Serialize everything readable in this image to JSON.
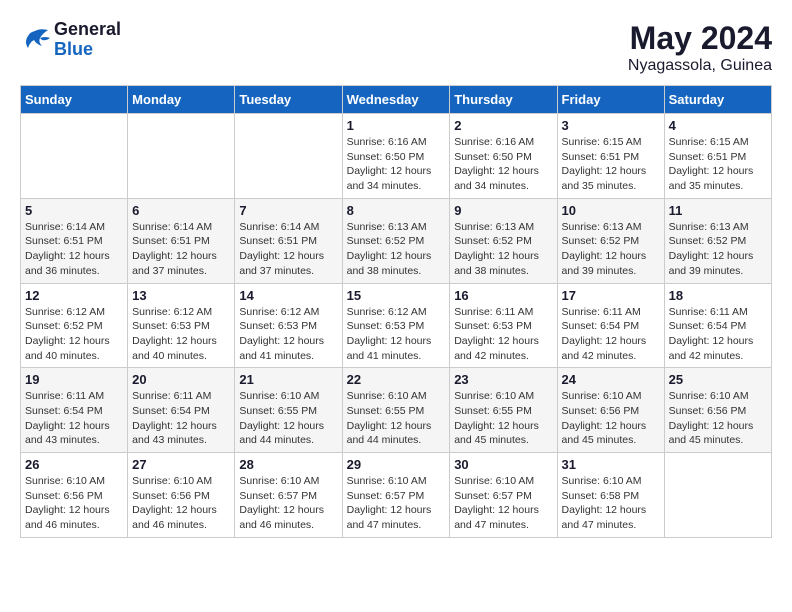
{
  "header": {
    "logo_line1": "General",
    "logo_line2": "Blue",
    "main_title": "May 2024",
    "subtitle": "Nyagassola, Guinea"
  },
  "days_of_week": [
    "Sunday",
    "Monday",
    "Tuesday",
    "Wednesday",
    "Thursday",
    "Friday",
    "Saturday"
  ],
  "weeks": [
    [
      {
        "day": "",
        "info": ""
      },
      {
        "day": "",
        "info": ""
      },
      {
        "day": "",
        "info": ""
      },
      {
        "day": "1",
        "info": "Sunrise: 6:16 AM\nSunset: 6:50 PM\nDaylight: 12 hours\nand 34 minutes."
      },
      {
        "day": "2",
        "info": "Sunrise: 6:16 AM\nSunset: 6:50 PM\nDaylight: 12 hours\nand 34 minutes."
      },
      {
        "day": "3",
        "info": "Sunrise: 6:15 AM\nSunset: 6:51 PM\nDaylight: 12 hours\nand 35 minutes."
      },
      {
        "day": "4",
        "info": "Sunrise: 6:15 AM\nSunset: 6:51 PM\nDaylight: 12 hours\nand 35 minutes."
      }
    ],
    [
      {
        "day": "5",
        "info": "Sunrise: 6:14 AM\nSunset: 6:51 PM\nDaylight: 12 hours\nand 36 minutes."
      },
      {
        "day": "6",
        "info": "Sunrise: 6:14 AM\nSunset: 6:51 PM\nDaylight: 12 hours\nand 37 minutes."
      },
      {
        "day": "7",
        "info": "Sunrise: 6:14 AM\nSunset: 6:51 PM\nDaylight: 12 hours\nand 37 minutes."
      },
      {
        "day": "8",
        "info": "Sunrise: 6:13 AM\nSunset: 6:52 PM\nDaylight: 12 hours\nand 38 minutes."
      },
      {
        "day": "9",
        "info": "Sunrise: 6:13 AM\nSunset: 6:52 PM\nDaylight: 12 hours\nand 38 minutes."
      },
      {
        "day": "10",
        "info": "Sunrise: 6:13 AM\nSunset: 6:52 PM\nDaylight: 12 hours\nand 39 minutes."
      },
      {
        "day": "11",
        "info": "Sunrise: 6:13 AM\nSunset: 6:52 PM\nDaylight: 12 hours\nand 39 minutes."
      }
    ],
    [
      {
        "day": "12",
        "info": "Sunrise: 6:12 AM\nSunset: 6:52 PM\nDaylight: 12 hours\nand 40 minutes."
      },
      {
        "day": "13",
        "info": "Sunrise: 6:12 AM\nSunset: 6:53 PM\nDaylight: 12 hours\nand 40 minutes."
      },
      {
        "day": "14",
        "info": "Sunrise: 6:12 AM\nSunset: 6:53 PM\nDaylight: 12 hours\nand 41 minutes."
      },
      {
        "day": "15",
        "info": "Sunrise: 6:12 AM\nSunset: 6:53 PM\nDaylight: 12 hours\nand 41 minutes."
      },
      {
        "day": "16",
        "info": "Sunrise: 6:11 AM\nSunset: 6:53 PM\nDaylight: 12 hours\nand 42 minutes."
      },
      {
        "day": "17",
        "info": "Sunrise: 6:11 AM\nSunset: 6:54 PM\nDaylight: 12 hours\nand 42 minutes."
      },
      {
        "day": "18",
        "info": "Sunrise: 6:11 AM\nSunset: 6:54 PM\nDaylight: 12 hours\nand 42 minutes."
      }
    ],
    [
      {
        "day": "19",
        "info": "Sunrise: 6:11 AM\nSunset: 6:54 PM\nDaylight: 12 hours\nand 43 minutes."
      },
      {
        "day": "20",
        "info": "Sunrise: 6:11 AM\nSunset: 6:54 PM\nDaylight: 12 hours\nand 43 minutes."
      },
      {
        "day": "21",
        "info": "Sunrise: 6:10 AM\nSunset: 6:55 PM\nDaylight: 12 hours\nand 44 minutes."
      },
      {
        "day": "22",
        "info": "Sunrise: 6:10 AM\nSunset: 6:55 PM\nDaylight: 12 hours\nand 44 minutes."
      },
      {
        "day": "23",
        "info": "Sunrise: 6:10 AM\nSunset: 6:55 PM\nDaylight: 12 hours\nand 45 minutes."
      },
      {
        "day": "24",
        "info": "Sunrise: 6:10 AM\nSunset: 6:56 PM\nDaylight: 12 hours\nand 45 minutes."
      },
      {
        "day": "25",
        "info": "Sunrise: 6:10 AM\nSunset: 6:56 PM\nDaylight: 12 hours\nand 45 minutes."
      }
    ],
    [
      {
        "day": "26",
        "info": "Sunrise: 6:10 AM\nSunset: 6:56 PM\nDaylight: 12 hours\nand 46 minutes."
      },
      {
        "day": "27",
        "info": "Sunrise: 6:10 AM\nSunset: 6:56 PM\nDaylight: 12 hours\nand 46 minutes."
      },
      {
        "day": "28",
        "info": "Sunrise: 6:10 AM\nSunset: 6:57 PM\nDaylight: 12 hours\nand 46 minutes."
      },
      {
        "day": "29",
        "info": "Sunrise: 6:10 AM\nSunset: 6:57 PM\nDaylight: 12 hours\nand 47 minutes."
      },
      {
        "day": "30",
        "info": "Sunrise: 6:10 AM\nSunset: 6:57 PM\nDaylight: 12 hours\nand 47 minutes."
      },
      {
        "day": "31",
        "info": "Sunrise: 6:10 AM\nSunset: 6:58 PM\nDaylight: 12 hours\nand 47 minutes."
      },
      {
        "day": "",
        "info": ""
      }
    ]
  ]
}
